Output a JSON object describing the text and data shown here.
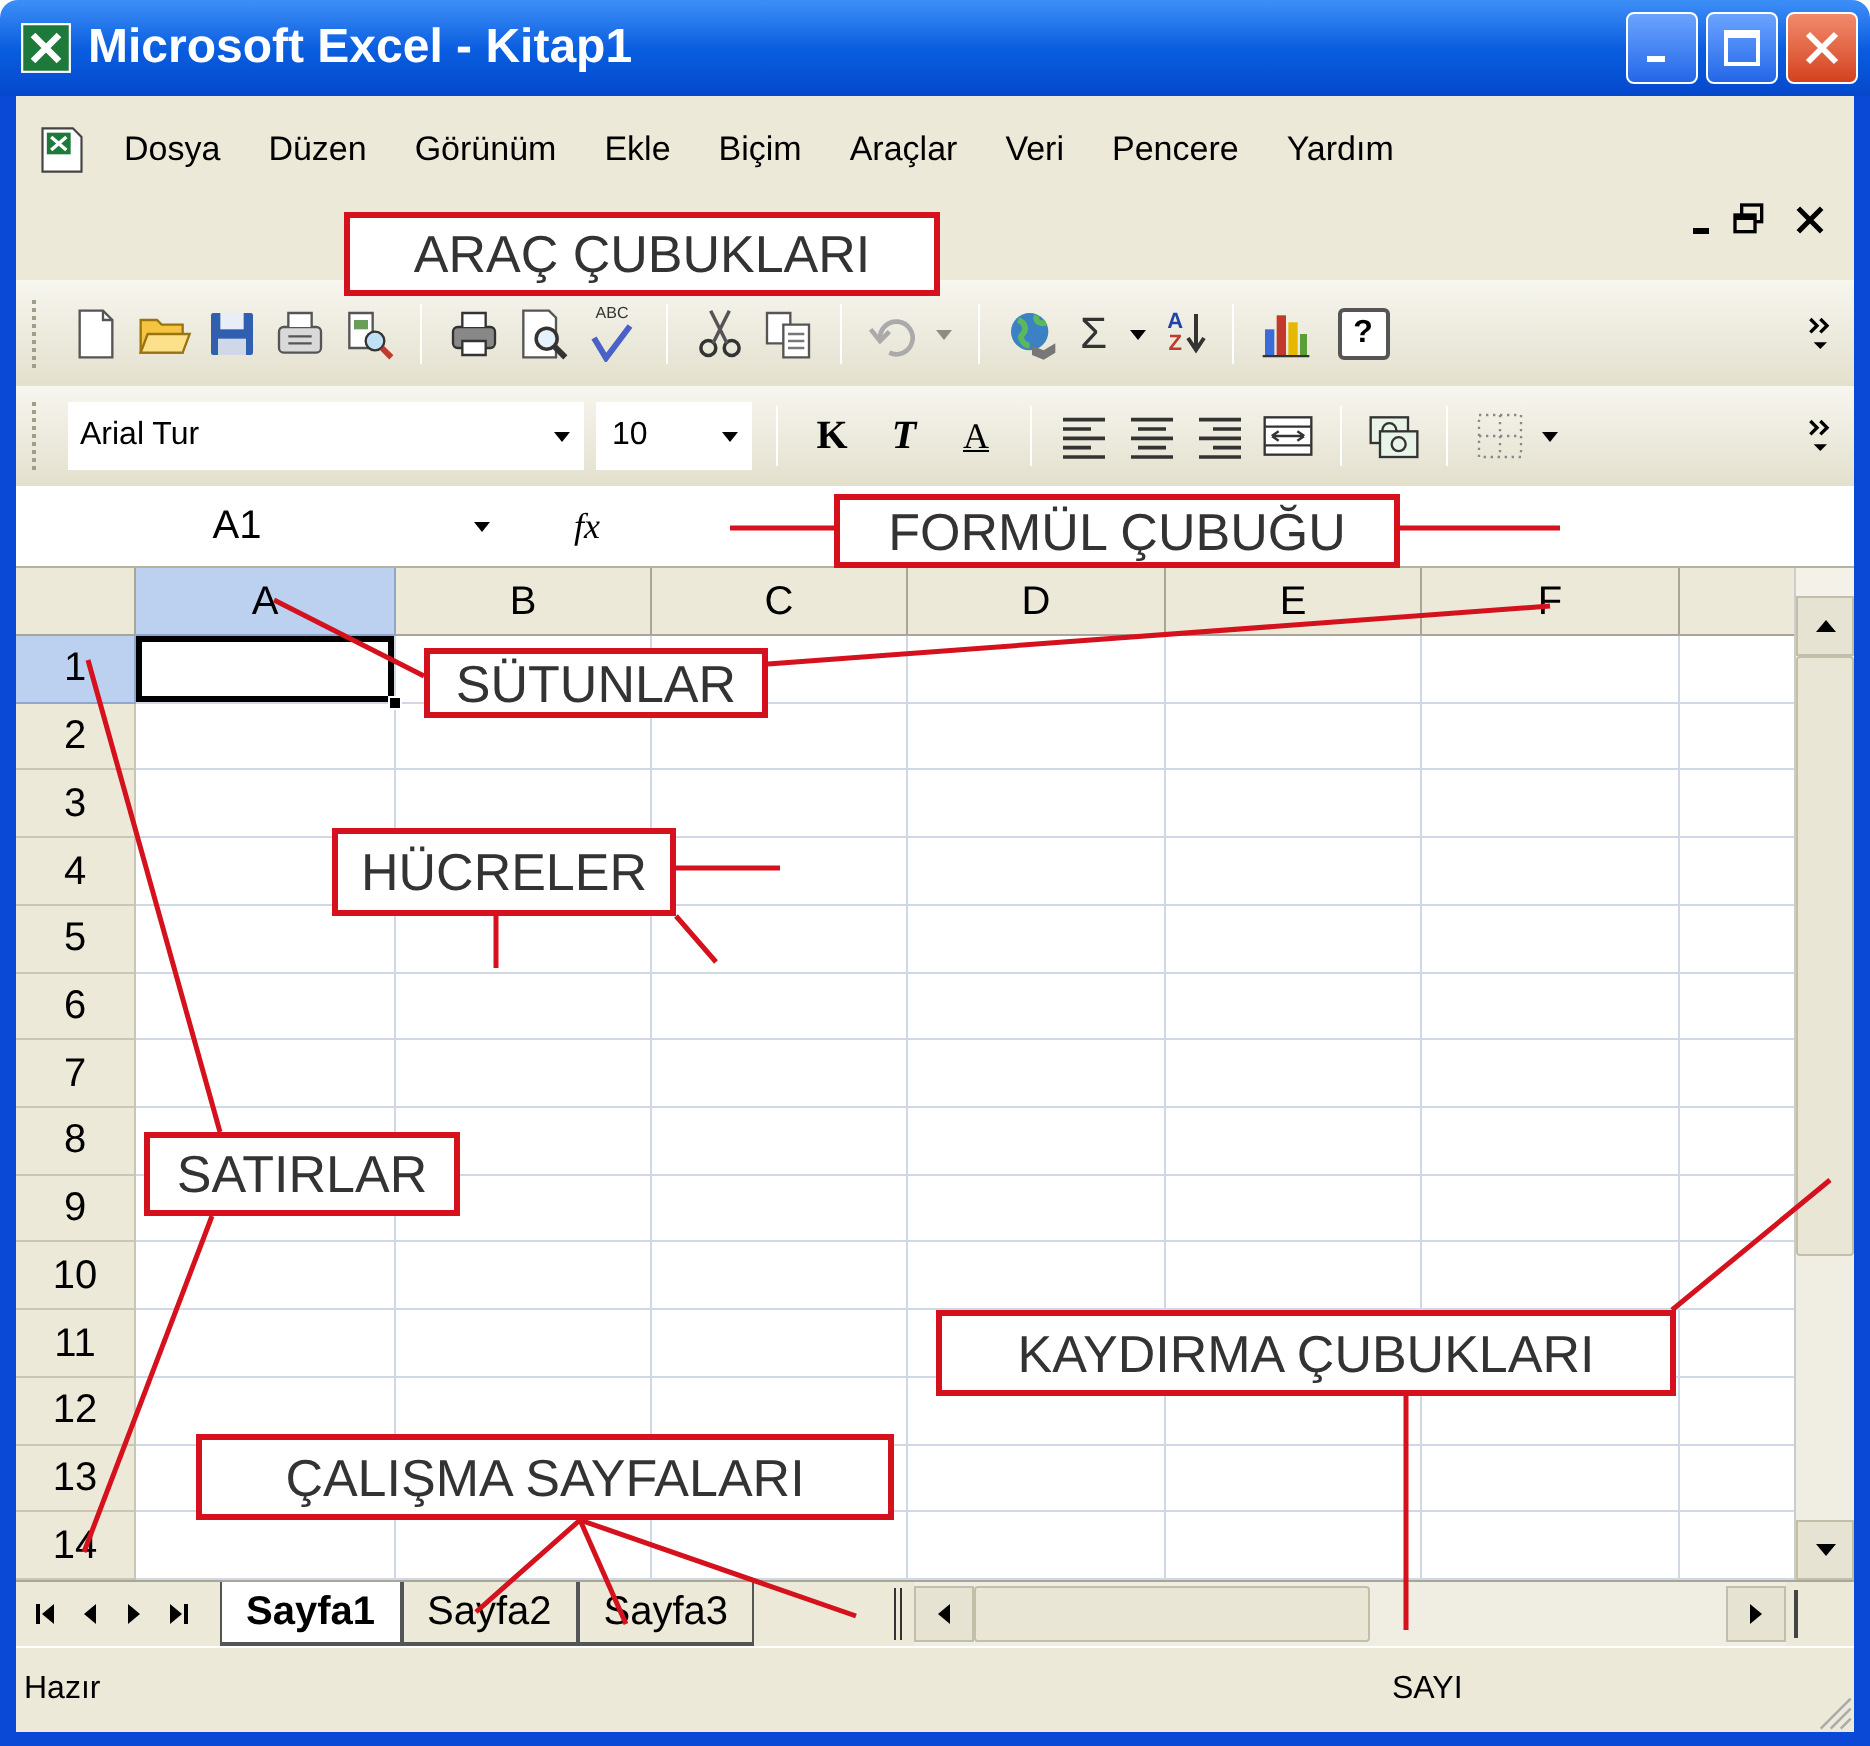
{
  "window": {
    "title": "Microsoft Excel - Kitap1"
  },
  "menu_bar": {
    "items": [
      "Dosya",
      "Düzen",
      "Görünüm",
      "Ekle",
      "Biçim",
      "Araçlar",
      "Veri",
      "Pencere",
      "Yardım"
    ]
  },
  "standard_toolbar": {
    "spelling_label": "ABC",
    "sum_symbol": "Σ",
    "sort_letters": [
      "A",
      "Z"
    ],
    "help_symbol": "?"
  },
  "formatting_toolbar": {
    "font": "Arial Tur",
    "size": "10",
    "bold_label": "K",
    "italic_label": "T",
    "underline_label": "A"
  },
  "formula_bar": {
    "name_box": "A1",
    "function_label": "fx"
  },
  "sheet": {
    "columns": [
      {
        "label": "A",
        "selected": true
      },
      {
        "label": "B",
        "selected": false
      },
      {
        "label": "C",
        "selected": false
      },
      {
        "label": "D",
        "selected": false
      },
      {
        "label": "E",
        "selected": false
      },
      {
        "label": "F",
        "selected": false
      }
    ],
    "rows": [
      {
        "label": "1",
        "selected": true
      },
      {
        "label": "2",
        "selected": false
      },
      {
        "label": "3",
        "selected": false
      },
      {
        "label": "4",
        "selected": false
      },
      {
        "label": "5",
        "selected": false
      },
      {
        "label": "6",
        "selected": false
      },
      {
        "label": "7",
        "selected": false
      },
      {
        "label": "8",
        "selected": false
      },
      {
        "label": "9",
        "selected": false
      },
      {
        "label": "10",
        "selected": false
      },
      {
        "label": "11",
        "selected": false
      },
      {
        "label": "12",
        "selected": false
      },
      {
        "label": "13",
        "selected": false
      },
      {
        "label": "14",
        "selected": false
      }
    ]
  },
  "sheet_tabs": [
    {
      "label": "Sayfa1",
      "selected": true
    },
    {
      "label": "Sayfa2",
      "selected": false
    },
    {
      "label": "Sayfa3",
      "selected": false
    }
  ],
  "status_bar": {
    "state": "Hazır",
    "mode": "SAYI"
  },
  "annotations": [
    {
      "text": "ARAÇ ÇUBUKLARI"
    },
    {
      "text": "FORMÜL ÇUBUĞU"
    },
    {
      "text": "SÜTUNLAR"
    },
    {
      "text": "HÜCRELER"
    },
    {
      "text": "SATIRLAR"
    },
    {
      "text": "KAYDIRMA ÇUBUKLARI"
    },
    {
      "text": "ÇALIŞMA SAYFALARI"
    }
  ]
}
